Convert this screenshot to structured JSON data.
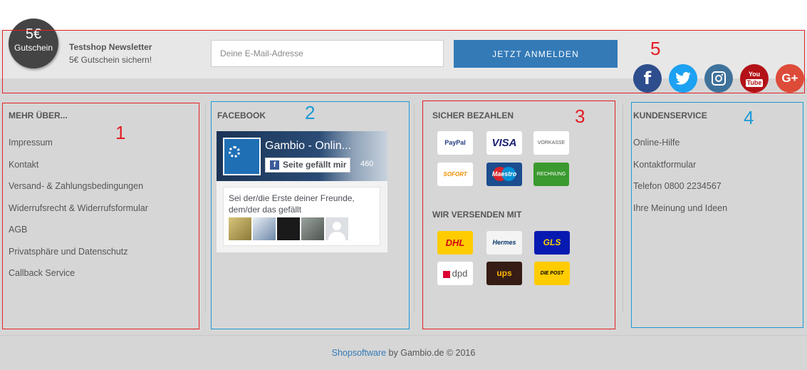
{
  "newsletter": {
    "badge_amount": "5€",
    "badge_label": "Gutschein",
    "title": "Testshop Newsletter",
    "subtitle": "5€ Gutschein sichern!",
    "email_placeholder": "Deine E-Mail-Adresse",
    "submit_label": "JETZT ANMELDEN"
  },
  "social": [
    {
      "name": "facebook-icon",
      "glyph": "f",
      "color": "#2d4d8c"
    },
    {
      "name": "twitter-icon",
      "glyph": "🐦",
      "color": "#1da1f2"
    },
    {
      "name": "instagram-icon",
      "glyph": "◎",
      "color": "#3f729b"
    },
    {
      "name": "youtube-icon",
      "glyph": "You\nTube",
      "color": "#b31217"
    },
    {
      "name": "google-plus-icon",
      "glyph": "G+",
      "color": "#dd4b39"
    }
  ],
  "annotations": {
    "col1": "1",
    "col2": "2",
    "col3": "3",
    "col4": "4",
    "newsletter": "5"
  },
  "mehr_ueber": {
    "title": "MEHR ÜBER...",
    "links": [
      "Impressum",
      "Kontakt",
      "Versand- & Zahlungsbedingungen",
      "Widerrufsrecht & Widerrufsformular",
      "AGB",
      "Privatsphäre und Datenschutz",
      "Callback Service"
    ]
  },
  "facebook": {
    "title": "FACEBOOK",
    "page_name": "Gambio - Onlin...",
    "like_label": "Seite gefällt mir",
    "like_count": "460",
    "friends_text": "Sei der/die Erste deiner Freunde, dem/der das gefällt"
  },
  "payment": {
    "title": "SICHER BEZAHLEN",
    "methods": [
      "PayPal",
      "VISA",
      "VORKASSE",
      "SOFORT",
      "Maestro",
      "RECHNUNG"
    ]
  },
  "shipping": {
    "title": "WIR VERSENDEN MIT",
    "carriers": [
      "DHL",
      "Hermes",
      "GLS",
      "dpd",
      "ups",
      "DIE POST"
    ]
  },
  "kundenservice": {
    "title": "KUNDENSERVICE",
    "links": [
      "Online-Hilfe",
      "Kontaktformular",
      "Telefon 0800 2234567",
      "Ihre Meinung und Ideen"
    ]
  },
  "footer": {
    "link_text": "Shopsoftware",
    "suffix": " by Gambio.de © 2016"
  }
}
